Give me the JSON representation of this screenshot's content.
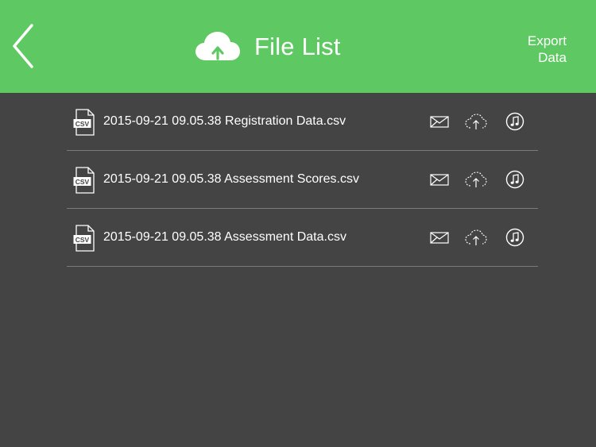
{
  "header": {
    "title": "File List",
    "export_label_line1": "Export",
    "export_label_line2": "Data",
    "background_color": "#5ec862",
    "title_icon": "cloud-upload-icon",
    "back_icon": "chevron-left-icon"
  },
  "files": [
    {
      "name": "2015-09-21 09.05.38 Registration Data.csv",
      "type_badge": "CSV"
    },
    {
      "name": "2015-09-21 09.05.38 Assessment Scores.csv",
      "type_badge": "CSV"
    },
    {
      "name": "2015-09-21 09.05.38 Assessment Data.csv",
      "type_badge": "CSV"
    }
  ],
  "row_actions": [
    "mail-icon",
    "cloud-upload-icon",
    "itunes-music-icon"
  ],
  "theme": {
    "background": "#444444",
    "divider": "#7a7a7a"
  }
}
